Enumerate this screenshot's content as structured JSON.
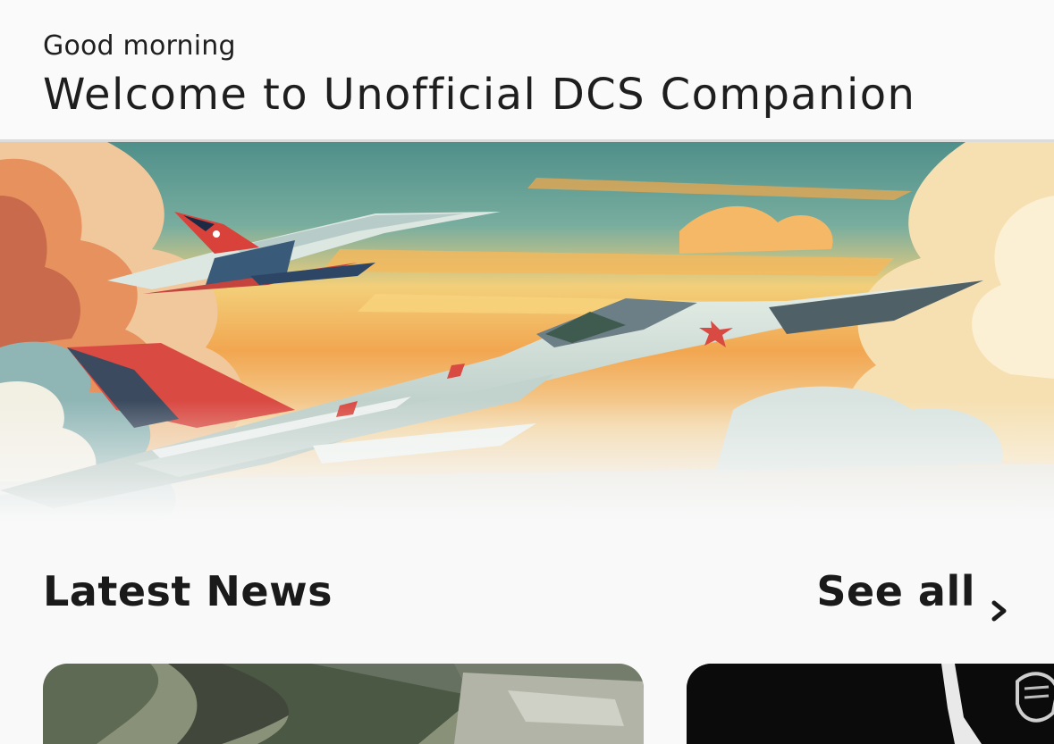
{
  "header": {
    "greeting": "Good morning",
    "title": "Welcome to Unofficial DCS Companion"
  },
  "hero": {
    "image_icon": "jet-fighters-illustration"
  },
  "news": {
    "section_title": "Latest News",
    "see_all_label": "See all",
    "see_all_icon": "chevron-right-icon",
    "cards": [
      {
        "image_icon": "camouflage-aircraft-photo"
      },
      {
        "image_icon": "cockpit-night-photo"
      }
    ]
  },
  "colors": {
    "background": "#f9f9f9",
    "text": "#1c1c1c",
    "sky_teal": "#5f9c90",
    "sunset_orange": "#f0a848",
    "jet_red": "#e0483e"
  }
}
